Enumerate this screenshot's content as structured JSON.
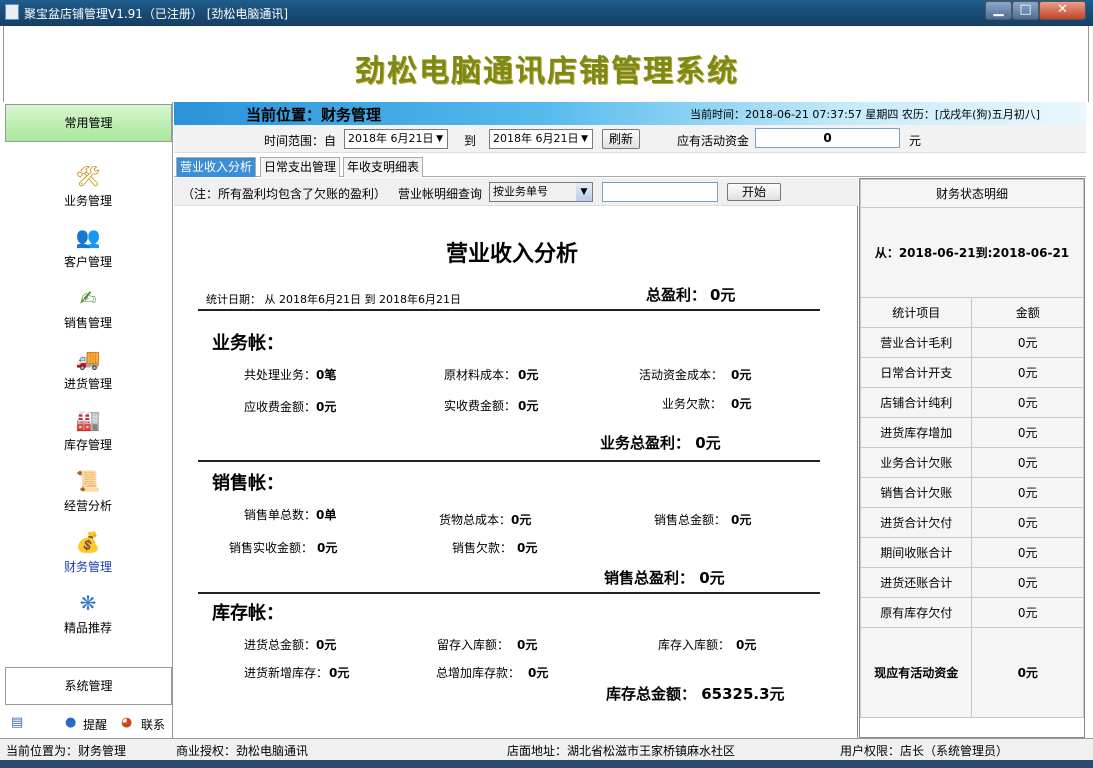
{
  "window": {
    "title": "聚宝盆店铺管理V1.91（已注册） [劲松电脑通讯]",
    "min_glyph": "▁",
    "max_glyph": "□",
    "close_glyph": "✕"
  },
  "banner": {
    "title": "劲松电脑通讯店铺管理系统"
  },
  "sidebar": {
    "header": "常用管理",
    "items": [
      {
        "label": "业务管理",
        "icon": "tools-icon",
        "glyph": "🛠",
        "color": "#c98a10"
      },
      {
        "label": "客户管理",
        "icon": "users-icon",
        "glyph": "👥",
        "color": "#2a8a2a"
      },
      {
        "label": "销售管理",
        "icon": "sales-icon",
        "glyph": "✍",
        "color": "#3a8a2a"
      },
      {
        "label": "进货管理",
        "icon": "truck-icon",
        "glyph": "🚚",
        "color": "#c09020"
      },
      {
        "label": "库存管理",
        "icon": "warehouse-icon",
        "glyph": "🏭",
        "color": "#4a4ab0"
      },
      {
        "label": "经营分析",
        "icon": "analysis-icon",
        "glyph": "📜",
        "color": "#b08830"
      },
      {
        "label": "财务管理",
        "icon": "finance-icon",
        "glyph": "💰",
        "color": "#d09a10"
      },
      {
        "label": "精品推荐",
        "icon": "recommend-icon",
        "glyph": "❋",
        "color": "#3a7ac8"
      }
    ],
    "active": "财务管理",
    "system": "系统管理",
    "footer": {
      "reminder": "提醒",
      "contact": "联系"
    }
  },
  "topbar": {
    "position": "当前位置：财务管理",
    "time_text": "当前时间：2018-06-21 07:37:57 星期四  农历：[戊戌年(狗)五月初八]"
  },
  "range": {
    "label_from": "时间范围：自",
    "from_date": "2018年 6月21日",
    "label_to": "到",
    "to_date": "2018年 6月21日",
    "refresh": "刷新",
    "fund_label": "应有活动资金",
    "fund_value": "0",
    "unit": "元"
  },
  "tabs": [
    "营业收入分析",
    "日常支出管理",
    "年收支明细表"
  ],
  "query": {
    "note": "（注：所有盈利均包含了欠账的盈利）",
    "label": "营业帐明细查询",
    "select_value": "按业务单号",
    "input_value": "",
    "start": "开始"
  },
  "report": {
    "title": "营业收入分析",
    "stat_date": "统计日期：  从  2018年6月21日  到  2018年6月21日",
    "total_profit_label": "总盈利：",
    "total_profit_value": "0元",
    "business": {
      "heading": "业务帐：",
      "handled_label": "共处理业务：",
      "handled_value": "0笔",
      "material_label": "原材料成本：",
      "material_value": "0元",
      "fund_cost_label": "活动资金成本：",
      "fund_cost_value": "0元",
      "receivable_label": "应收费金额：",
      "receivable_value": "0元",
      "received_label": "实收费金额：",
      "received_value": "0元",
      "debt_label": "业务欠款：",
      "debt_value": "0元",
      "total": "业务总盈利：  0元"
    },
    "sales": {
      "heading": "销售帐：",
      "count_label": "销售单总数：",
      "count_value": "0单",
      "goods_cost_label": "货物总成本：",
      "goods_cost_value": "0元",
      "amount_label": "销售总金额：",
      "amount_value": "0元",
      "received_label": "销售实收金额：",
      "received_value": "0元",
      "debt_label": "销售欠款：",
      "debt_value": "0元",
      "total": "销售总盈利：  0元"
    },
    "stock": {
      "heading": "库存帐：",
      "purchase_label": "进货总金额：",
      "purchase_value": "0元",
      "retained_label": "留存入库额：",
      "retained_value": "0元",
      "instock_label": "库存入库额：",
      "instock_value": "0元",
      "new_label": "进货新增库存：",
      "new_value": "0元",
      "increase_label": "总增加库存款：",
      "increase_value": "0元",
      "total": "库存总金额：  65325.3元"
    }
  },
  "panel": {
    "title": "财务状态明细",
    "range": "从：2018-06-21到:2018-06-21",
    "col_item": "统计项目",
    "col_amount": "金额",
    "rows": [
      {
        "item": "营业合计毛利",
        "amount": "0元"
      },
      {
        "item": "日常合计开支",
        "amount": "0元"
      },
      {
        "item": "店铺合计纯利",
        "amount": "0元"
      },
      {
        "item": "进货库存增加",
        "amount": "0元"
      },
      {
        "item": "业务合计欠账",
        "amount": "0元"
      },
      {
        "item": "销售合计欠账",
        "amount": "0元"
      },
      {
        "item": "进货合计欠付",
        "amount": "0元"
      },
      {
        "item": "期间收账合计",
        "amount": "0元"
      },
      {
        "item": "进货还账合计",
        "amount": "0元"
      },
      {
        "item": "原有库存欠付",
        "amount": "0元"
      }
    ],
    "final_item": "现应有活动资金",
    "final_amount": "0元"
  },
  "status": {
    "position": "当前位置为：财务管理",
    "license": "商业授权：劲松电脑通讯",
    "address": "店面地址：湖北省松滋市王家桥镇麻水社区",
    "permission": "用户权限：店长（系统管理员）"
  },
  "colors": {
    "accent": "#3d8fd4",
    "title": "#7a8a1a",
    "active_nav": "#1a3eb0"
  }
}
